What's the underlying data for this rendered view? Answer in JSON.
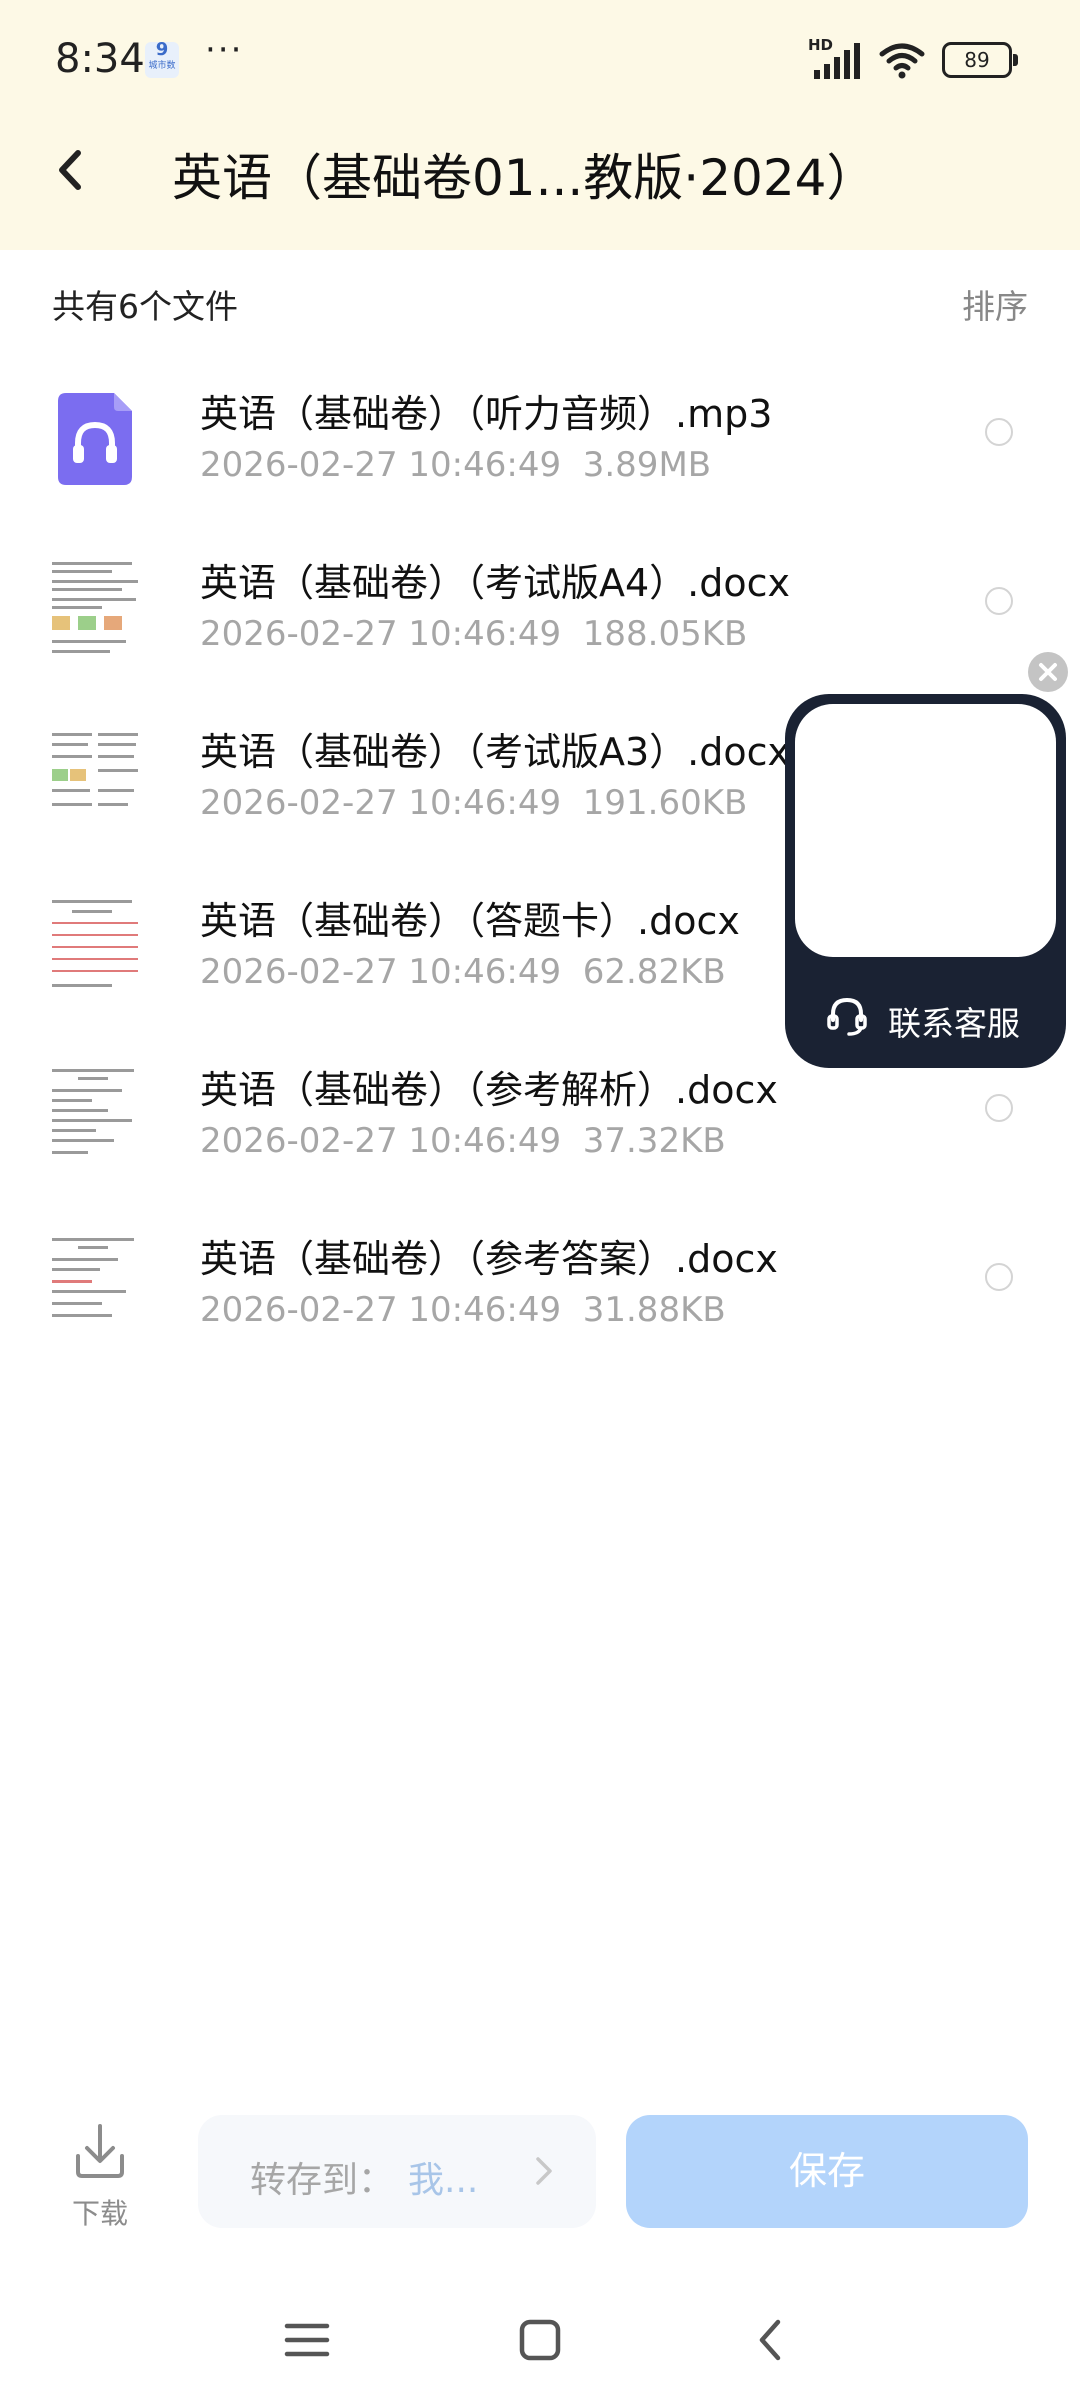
{
  "status_bar": {
    "time": "8:34",
    "badge_number": "9",
    "badge_label": "城市数",
    "overflow": "···",
    "network": "HD",
    "battery": "89"
  },
  "nav": {
    "title": "英语（基础卷01...教版·2024）",
    "back_icon": "chevron-left-icon"
  },
  "list": {
    "count_label": "共有6个文件",
    "sort_label": "排序",
    "files": [
      {
        "name": "英语（基础卷）（听力音频）.mp3",
        "date": "2026-02-27  10:46:49",
        "size": "3.89MB",
        "type": "audio"
      },
      {
        "name": "英语（基础卷）（考试版A4）.docx",
        "date": "2026-02-27  10:46:49",
        "size": "188.05KB",
        "type": "doc"
      },
      {
        "name": "英语（基础卷）（考试版A3）.docx",
        "date": "2026-02-27  10:46:49",
        "size": "191.60KB",
        "type": "doc"
      },
      {
        "name": "英语（基础卷）（答题卡）.docx",
        "date": "2026-02-27  10:46:49",
        "size": "62.82KB",
        "type": "doc"
      },
      {
        "name": "英语（基础卷）（参考解析）.docx",
        "date": "2026-02-27  10:46:49",
        "size": "37.32KB",
        "type": "doc"
      },
      {
        "name": "英语（基础卷）（参考答案）.docx",
        "date": "2026-02-27  10:46:49",
        "size": "31.88KB",
        "type": "doc"
      }
    ]
  },
  "customer_service": {
    "label": "联系客服",
    "icon": "headset-icon",
    "close_icon": "close-icon"
  },
  "bottom_bar": {
    "download_label": "下载",
    "save_to_label": "转存到：",
    "save_to_target": "我...",
    "save_label": "保存"
  },
  "colors": {
    "header_bg": "#fdf9e6",
    "accent": "#b3d4fb",
    "muted_text": "#a6a6a6",
    "audio_icon": "#7b6df0",
    "widget_bg": "#1a2233"
  }
}
